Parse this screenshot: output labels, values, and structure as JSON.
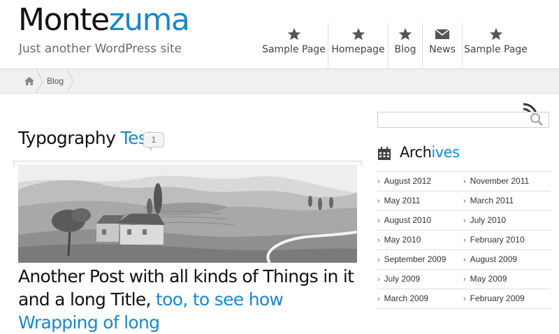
{
  "site": {
    "title_part1": "Monte",
    "title_part2": "zuma",
    "tagline": "Just another WordPress site"
  },
  "nav": [
    {
      "label": "Sample Page",
      "icon": "star-icon"
    },
    {
      "label": "Homepage",
      "icon": "star-icon"
    },
    {
      "label": "Blog",
      "icon": "star-icon"
    },
    {
      "label": "News",
      "icon": "envelope-icon"
    },
    {
      "label": "Sample Page",
      "icon": "star-icon"
    }
  ],
  "breadcrumb": {
    "home_icon": "home-icon",
    "current": "Blog"
  },
  "post": {
    "title_part1": "Typography ",
    "title_part2": "Test",
    "comment_count": "1",
    "image_alt_icon": "landscape-image",
    "headline_part1": "Another Post with all kinds of Things in it and a long Title, ",
    "headline_part2": "too, to see how Wrapping of long"
  },
  "sidebar": {
    "rss_icon": "rss-icon",
    "search_icon": "search-icon",
    "archives_icon": "calendar-icon",
    "archives_title_part1": "Arch",
    "archives_title_part2": "ives",
    "archives": [
      [
        "August 2012",
        "November 2011"
      ],
      [
        "May 2011",
        "March 2011"
      ],
      [
        "August 2010",
        "July 2010"
      ],
      [
        "May 2010",
        "February 2010"
      ],
      [
        "September 2009",
        "August 2009"
      ],
      [
        "July 2009",
        "May 2009"
      ],
      [
        "March 2009",
        "February 2009"
      ]
    ]
  },
  "colors": {
    "accent": "#1b87c9",
    "text": "#111111",
    "muted": "#6b6b6b",
    "breadcrumb_bg": "#f0f0f0"
  }
}
